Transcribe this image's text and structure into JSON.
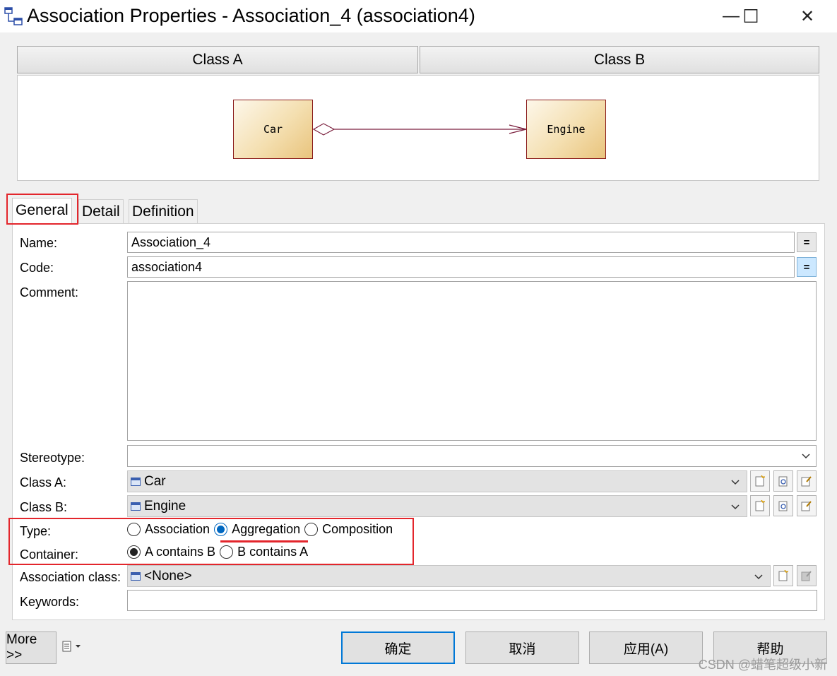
{
  "window": {
    "title": "Association Properties - Association_4 (association4)",
    "minimize_glyph": "—",
    "maximize_glyph": "☐",
    "close_glyph": "✕"
  },
  "header": {
    "class_a_label": "Class A",
    "class_b_label": "Class B"
  },
  "diagram": {
    "class_a_name": "Car",
    "class_b_name": "Engine"
  },
  "tabs": [
    {
      "label": "General"
    },
    {
      "label": "Detail"
    },
    {
      "label": "Definition"
    }
  ],
  "general": {
    "name": {
      "label": "Name:",
      "value": "Association_4"
    },
    "code": {
      "label": "Code:",
      "value": "association4"
    },
    "comment": {
      "label": "Comment:",
      "value": ""
    },
    "stereotype": {
      "label": "Stereotype:",
      "value": ""
    },
    "class_a": {
      "label": "Class A:",
      "value": "Car"
    },
    "class_b": {
      "label": "Class B:",
      "value": "Engine"
    },
    "type": {
      "label": "Type:",
      "options": [
        "Association",
        "Aggregation",
        "Composition"
      ],
      "selected": "Aggregation"
    },
    "container": {
      "label": "Container:",
      "options": [
        "A contains B",
        "B contains A"
      ],
      "selected": "A contains B"
    },
    "association_class": {
      "label": "Association class:",
      "value": "<None>"
    },
    "keywords": {
      "label": "Keywords:",
      "value": ""
    },
    "equals_glyph": "="
  },
  "footer": {
    "more_label": "More >>",
    "ok_label": "确定",
    "cancel_label": "取消",
    "apply_label": "应用(A)",
    "help_label": "帮助"
  },
  "watermark": "CSDN @蜡笔超级小新",
  "colors": {
    "accent": "#0067c0",
    "highlight_red": "#e3262c",
    "assoc_line": "#7a1f3d"
  }
}
